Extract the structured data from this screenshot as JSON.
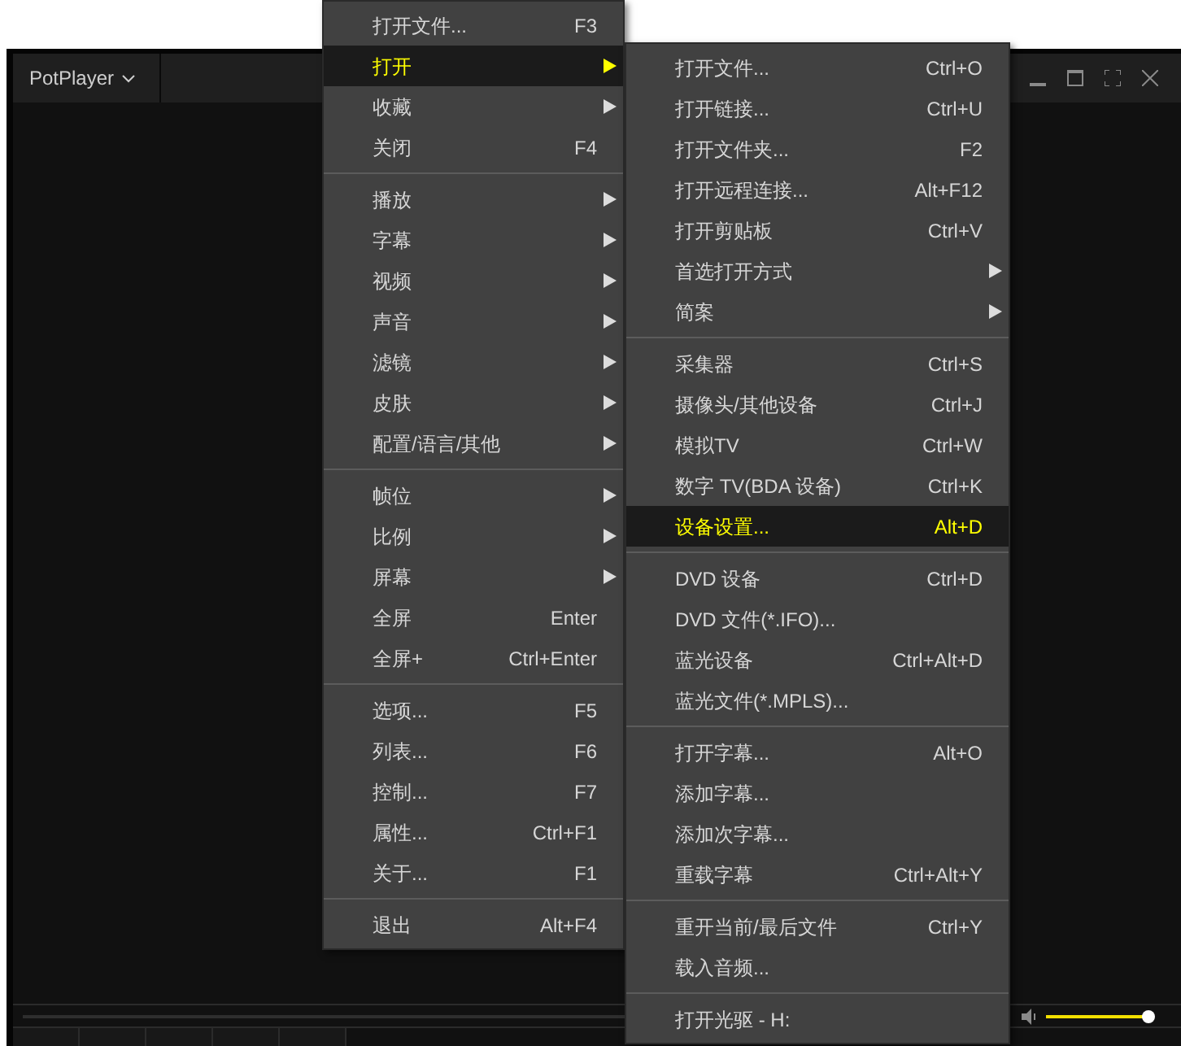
{
  "window": {
    "title": "PotPlayer"
  },
  "volume": {
    "level": 0.95
  },
  "main_menu": [
    {
      "kind": "item",
      "label": "打开文件...",
      "shortcut": "F3",
      "has_submenu": false,
      "selected": false
    },
    {
      "kind": "item",
      "label": "打开",
      "has_submenu": true,
      "selected": true
    },
    {
      "kind": "item",
      "label": "收藏",
      "has_submenu": true,
      "selected": false
    },
    {
      "kind": "item",
      "label": "关闭",
      "shortcut": "F4",
      "has_submenu": false,
      "selected": false
    },
    {
      "kind": "separator"
    },
    {
      "kind": "item",
      "label": "播放",
      "has_submenu": true,
      "selected": false
    },
    {
      "kind": "item",
      "label": "字幕",
      "has_submenu": true,
      "selected": false
    },
    {
      "kind": "item",
      "label": "视频",
      "has_submenu": true,
      "selected": false
    },
    {
      "kind": "item",
      "label": "声音",
      "has_submenu": true,
      "selected": false
    },
    {
      "kind": "item",
      "label": "滤镜",
      "has_submenu": true,
      "selected": false
    },
    {
      "kind": "item",
      "label": "皮肤",
      "has_submenu": true,
      "selected": false
    },
    {
      "kind": "item",
      "label": "配置/语言/其他",
      "has_submenu": true,
      "selected": false
    },
    {
      "kind": "separator"
    },
    {
      "kind": "item",
      "label": "帧位",
      "has_submenu": true,
      "selected": false
    },
    {
      "kind": "item",
      "label": "比例",
      "has_submenu": true,
      "selected": false
    },
    {
      "kind": "item",
      "label": "屏幕",
      "has_submenu": true,
      "selected": false
    },
    {
      "kind": "item",
      "label": "全屏",
      "shortcut": "Enter",
      "has_submenu": false,
      "selected": false
    },
    {
      "kind": "item",
      "label": "全屏+",
      "shortcut": "Ctrl+Enter",
      "has_submenu": false,
      "selected": false
    },
    {
      "kind": "separator"
    },
    {
      "kind": "item",
      "label": "选项...",
      "shortcut": "F5",
      "has_submenu": false,
      "selected": false
    },
    {
      "kind": "item",
      "label": "列表...",
      "shortcut": "F6",
      "has_submenu": false,
      "selected": false
    },
    {
      "kind": "item",
      "label": "控制...",
      "shortcut": "F7",
      "has_submenu": false,
      "selected": false
    },
    {
      "kind": "item",
      "label": "属性...",
      "shortcut": "Ctrl+F1",
      "has_submenu": false,
      "selected": false
    },
    {
      "kind": "item",
      "label": "关于...",
      "shortcut": "F1",
      "has_submenu": false,
      "selected": false
    },
    {
      "kind": "separator"
    },
    {
      "kind": "item",
      "label": "退出",
      "shortcut": "Alt+F4",
      "has_submenu": false,
      "selected": false
    }
  ],
  "submenu": [
    {
      "kind": "item",
      "label": "打开文件...",
      "shortcut": "Ctrl+O",
      "has_submenu": false,
      "selected": false
    },
    {
      "kind": "item",
      "label": "打开链接...",
      "shortcut": "Ctrl+U",
      "has_submenu": false,
      "selected": false
    },
    {
      "kind": "item",
      "label": "打开文件夹...",
      "shortcut": "F2",
      "has_submenu": false,
      "selected": false
    },
    {
      "kind": "item",
      "label": "打开远程连接...",
      "shortcut": "Alt+F12",
      "has_submenu": false,
      "selected": false
    },
    {
      "kind": "item",
      "label": "打开剪贴板",
      "shortcut": "Ctrl+V",
      "has_submenu": false,
      "selected": false
    },
    {
      "kind": "item",
      "label": "首选打开方式",
      "has_submenu": true,
      "selected": false
    },
    {
      "kind": "item",
      "label": "简案",
      "has_submenu": true,
      "selected": false
    },
    {
      "kind": "separator"
    },
    {
      "kind": "item",
      "label": "采集器",
      "shortcut": "Ctrl+S",
      "has_submenu": false,
      "selected": false
    },
    {
      "kind": "item",
      "label": "摄像头/其他设备",
      "shortcut": "Ctrl+J",
      "has_submenu": false,
      "selected": false
    },
    {
      "kind": "item",
      "label": "模拟TV",
      "shortcut": "Ctrl+W",
      "has_submenu": false,
      "selected": false
    },
    {
      "kind": "item",
      "label": "数字 TV(BDA 设备)",
      "shortcut": "Ctrl+K",
      "has_submenu": false,
      "selected": false
    },
    {
      "kind": "item",
      "label": "设备设置...",
      "shortcut": "Alt+D",
      "has_submenu": false,
      "selected": true
    },
    {
      "kind": "separator"
    },
    {
      "kind": "item",
      "label": "DVD 设备",
      "shortcut": "Ctrl+D",
      "has_submenu": false,
      "selected": false
    },
    {
      "kind": "item",
      "label": "DVD 文件(*.IFO)...",
      "has_submenu": false,
      "selected": false
    },
    {
      "kind": "item",
      "label": "蓝光设备",
      "shortcut": "Ctrl+Alt+D",
      "has_submenu": false,
      "selected": false
    },
    {
      "kind": "item",
      "label": "蓝光文件(*.MPLS)...",
      "has_submenu": false,
      "selected": false
    },
    {
      "kind": "separator"
    },
    {
      "kind": "item",
      "label": "打开字幕...",
      "shortcut": "Alt+O",
      "has_submenu": false,
      "selected": false
    },
    {
      "kind": "item",
      "label": "添加字幕...",
      "has_submenu": false,
      "selected": false
    },
    {
      "kind": "item",
      "label": "添加次字幕...",
      "has_submenu": false,
      "selected": false
    },
    {
      "kind": "item",
      "label": "重载字幕",
      "shortcut": "Ctrl+Alt+Y",
      "has_submenu": false,
      "selected": false
    },
    {
      "kind": "separator"
    },
    {
      "kind": "item",
      "label": "重开当前/最后文件",
      "shortcut": "Ctrl+Y",
      "has_submenu": false,
      "selected": false
    },
    {
      "kind": "item",
      "label": "载入音频...",
      "has_submenu": false,
      "selected": false
    },
    {
      "kind": "separator"
    },
    {
      "kind": "item",
      "label": "打开光驱 - H:",
      "has_submenu": false,
      "selected": false
    }
  ]
}
